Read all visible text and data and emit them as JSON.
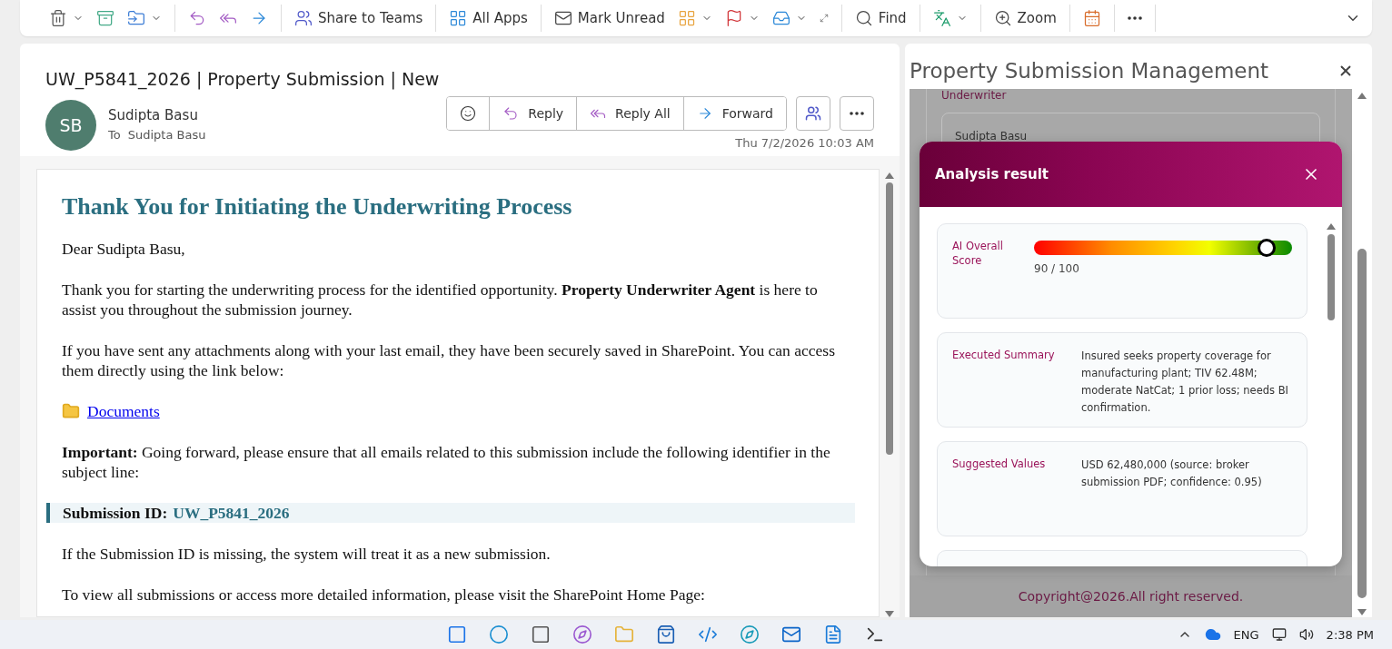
{
  "toolbar": {
    "groups": [
      [
        {
          "caret": true
        },
        {
          "caret": false
        },
        {
          "caret": true
        }
      ],
      [
        {
          "caret": false
        },
        {
          "caret": false
        },
        {
          "caret": false
        }
      ],
      [
        {
          "caret": false,
          "label": "Share to Teams"
        }
      ],
      [
        {
          "caret": false,
          "label": "All Apps"
        }
      ],
      [
        {
          "caret": false,
          "label": "Mark Unread"
        },
        {
          "caret": true
        },
        {
          "caret": true
        },
        {
          "caret": true
        }
      ],
      [
        {
          "caret": false,
          "label": "Find"
        }
      ],
      [
        {
          "caret": true
        }
      ],
      [
        {
          "caret": false,
          "label": "Zoom"
        }
      ],
      [
        {
          "caret": false
        }
      ],
      [
        {
          "caret": false
        }
      ]
    ]
  },
  "email": {
    "subject": "UW_P5841_2026 | Property Submission | New",
    "sender": {
      "initials": "SB",
      "name": "Sudipta Basu"
    },
    "to_label": "To",
    "recipient": "Sudipta Basu",
    "actions": [
      {
        "label": "Reply"
      },
      {
        "label": "Reply All"
      },
      {
        "label": "Forward"
      }
    ],
    "date": "Thu 7/2/2026 10:03 AM",
    "body": {
      "heading": "Thank You for Initiating the Underwriting Process",
      "blocks": [
        {
          "kind": "paragraph",
          "text": "Dear Sudipta Basu,"
        },
        {
          "kind": "paragraph",
          "text": "Thank you for starting the underwriting process for the identified opportunity. **Property Underwriter Agent** is here to assist you throughout the submission journey."
        },
        {
          "kind": "paragraph",
          "text": "If you have sent any attachments along with your last email, they have been securely saved in SharePoint. You can access them directly using the link below:"
        },
        {
          "kind": "link",
          "text": "Documents"
        },
        {
          "kind": "paragraph",
          "text": "**Important:** Going forward, please ensure that all emails related to this submission include the following identifier in the subject line:"
        },
        {
          "kind": "callout",
          "label": "Submission ID:",
          "value": "UW_P5841_2026"
        },
        {
          "kind": "paragraph",
          "text": "If the Submission ID is missing, the system will treat it as a new submission."
        },
        {
          "kind": "paragraph",
          "text": "To view all submissions or access more detailed information, please visit the SharePoint Home Page:"
        }
      ]
    }
  },
  "addin": {
    "title": "Property Submission Management",
    "form": {
      "label": "Underwriter",
      "value": "Sudipta Basu"
    },
    "modal": {
      "title": "Analysis result",
      "score": {
        "label": "AI Overall Score",
        "level": 0.9,
        "reading": "90 / 100"
      },
      "rows": [
        {
          "label": "Executed Summary",
          "value": "Insured seeks property coverage for manufacturing plant; TIV 62.48M; moderate NatCat; 1 prior loss; needs BI confirmation."
        },
        {
          "label": "Suggested Values",
          "value": "USD 62,480,000 (source: broker submission PDF; confidence: 0.95)"
        }
      ]
    },
    "footer": "Copyright@2026.All right reserved."
  },
  "taskbar": {
    "language": "ENG",
    "time": "2:38 PM"
  }
}
